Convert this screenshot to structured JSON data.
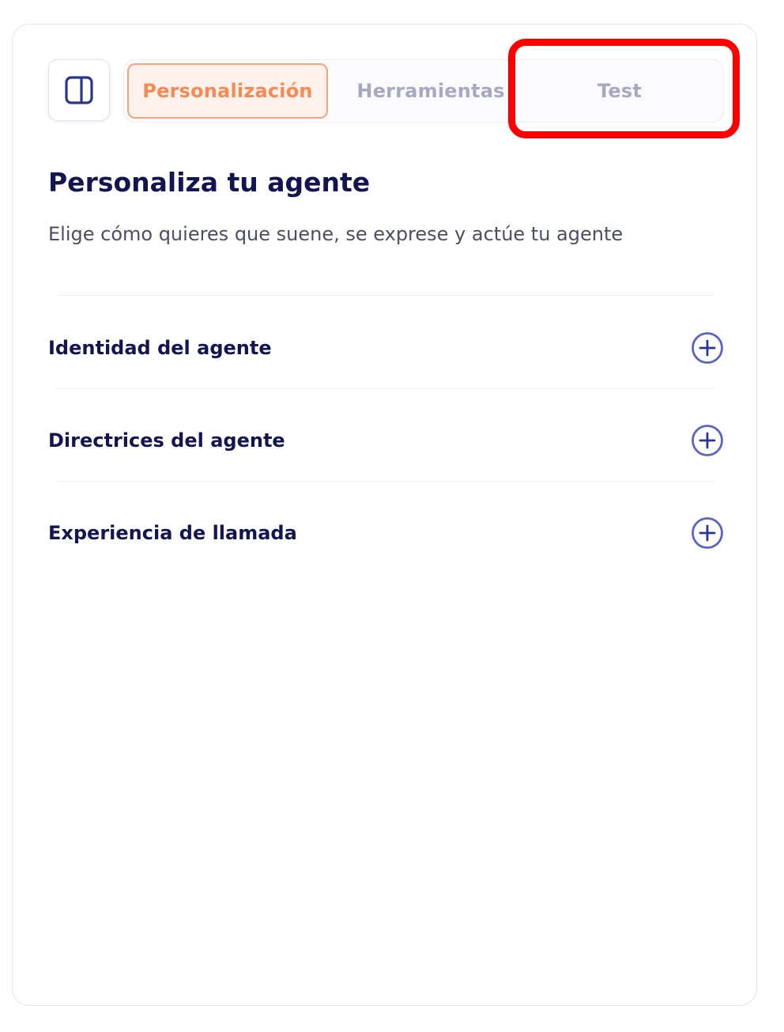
{
  "tabs": [
    {
      "label": "Personalización",
      "active": true
    },
    {
      "label": "Herramientas",
      "active": false
    },
    {
      "label": "Test",
      "active": false
    }
  ],
  "header": {
    "title": "Personaliza tu agente",
    "subtitle": "Elige cómo quieres que suene, se exprese y actúe tu agente"
  },
  "sections": [
    {
      "label": "Identidad del agente",
      "icon": "plus-circle-icon"
    },
    {
      "label": "Directrices del agente",
      "icon": "plus-circle-icon"
    },
    {
      "label": "Experiencia de llamada",
      "icon": "plus-circle-icon"
    }
  ],
  "icons": {
    "sidebar_toggle": "sidebar-panel-icon"
  },
  "colors": {
    "accent": "#f58a54",
    "accent_bg": "#fff2ec",
    "heading": "#121550",
    "icon": "#5a63c8",
    "highlight": "#ff0000"
  }
}
